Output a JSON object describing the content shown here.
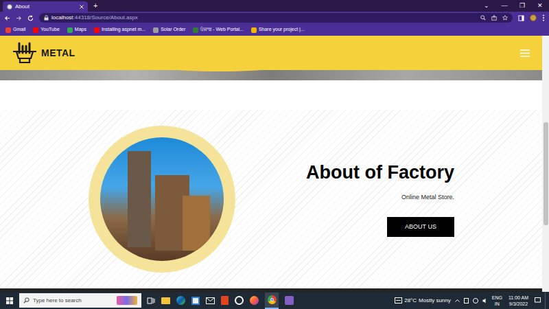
{
  "window": {
    "controls": [
      "⌄",
      "—",
      "❐",
      "✕"
    ]
  },
  "tabs": [
    {
      "label": "About",
      "selected": true
    }
  ],
  "new_tab": "+",
  "address": {
    "host": "localhost",
    "path": ":44318/Source/About.aspx"
  },
  "bookmarks": [
    {
      "label": "Gmail",
      "color": "#ea4335"
    },
    {
      "label": "YouTube",
      "color": "#ff0000"
    },
    {
      "label": "Maps",
      "color": "#34a853"
    },
    {
      "label": "Installing aspnet m...",
      "color": "#ff0000"
    },
    {
      "label": "Solar Order",
      "color": "#9e9e9e"
    },
    {
      "label": "ਪੰਜਾਬ - Web Portal...",
      "color": "#2e7d32"
    },
    {
      "label": "Share your project |...",
      "color": "#f4b400"
    }
  ],
  "site": {
    "brand": "METAL",
    "hero": {
      "title": "About of Factory",
      "subtitle": "Online Metal Store.",
      "button": "ABOUT US"
    }
  },
  "taskbar": {
    "search": "Type here to search",
    "weather": {
      "temp": "28°C",
      "text": "Mostly sunny"
    },
    "language": {
      "lang": "ENG",
      "region": "IN"
    },
    "clock": {
      "time": "11:00 AM",
      "date": "9/3/2022"
    }
  }
}
